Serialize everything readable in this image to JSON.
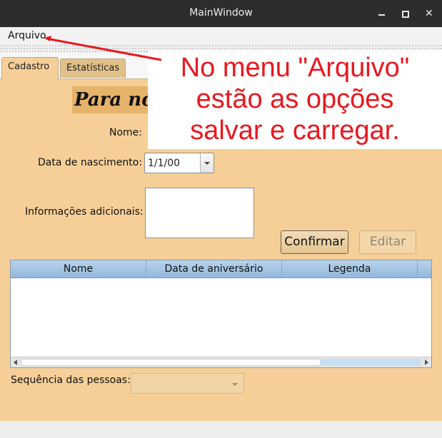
{
  "window": {
    "title": "MainWindow",
    "controls": {
      "minimize_icon": "minimize-icon",
      "maximize_icon": "maximize-icon",
      "close": "✕"
    }
  },
  "menubar": {
    "items": [
      {
        "label": "Arquivo"
      }
    ]
  },
  "tabs": [
    {
      "label": "Cadastro",
      "active": true
    },
    {
      "label": "Estatísticas",
      "active": false
    }
  ],
  "form": {
    "title": "Para nó",
    "nome_label": "Nome:",
    "data_label": "Data de nascimento:",
    "data_value": "1/1/00",
    "info_label": "Informações adicionais:",
    "info_value": "",
    "confirm_label": "Confirmar",
    "edit_label": "Editar"
  },
  "table": {
    "columns": [
      "Nome",
      "Data de aniversário",
      "Legenda"
    ],
    "rows": []
  },
  "sequence": {
    "label": "Sequência das pessoas:",
    "value": ""
  },
  "annotation": {
    "lines": [
      "No menu \"Arquivo\"",
      "estão as opções",
      "salvar e carregar."
    ],
    "color": "#e8181e"
  },
  "colors": {
    "panel_bg": "#f6cf98",
    "title_bg": "#e6b36a",
    "header_bg": "#93b8dc",
    "titlebar_bg": "#2d2d2d"
  }
}
